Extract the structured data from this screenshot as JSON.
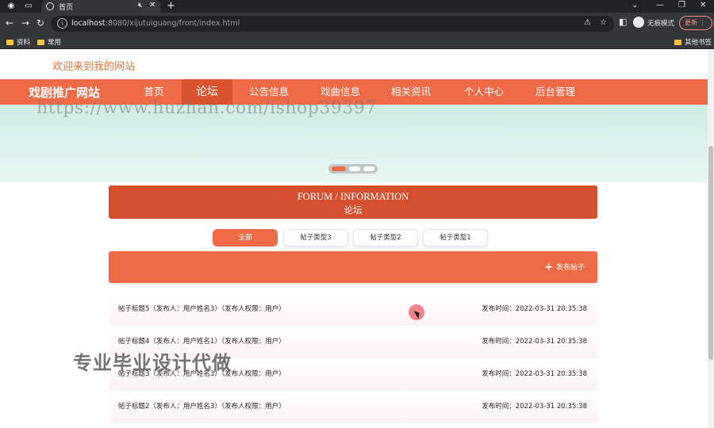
{
  "browser": {
    "tab_title": "首页",
    "url_host": "localhost",
    "url_rest": ":8080/xijutuiguang/front/index.html",
    "profile_label": "无痕模式",
    "update_label": "更新",
    "bookmarks": [
      "资料",
      "常用"
    ],
    "other_bookmarks": "其他书签"
  },
  "header": {
    "welcome": "欢迎来到我的网站",
    "brand": "戏剧推广网站"
  },
  "nav": {
    "items": [
      "首页",
      "论坛",
      "公告信息",
      "戏曲信息",
      "相关资讯",
      "个人中心",
      "后台管理"
    ],
    "active": "论坛"
  },
  "banner": {
    "watermark": "https://www.huzhan.com/ishop39397"
  },
  "forum": {
    "title_en": "FORUM / INFORMATION",
    "title_cn": "论坛",
    "filters": [
      "全部",
      "帖子类型3",
      "帖子类型2",
      "帖子类型1"
    ],
    "active_filter": "全部",
    "post_button": "发布帖子",
    "posts": [
      {
        "title": "帖子标题5（发布人：用户姓名3）（发布人权限：用户）",
        "time": "发布时间：2022-03-31 20:35:38"
      },
      {
        "title": "帖子标题4（发布人：用户姓名1）（发布人权限：用户）",
        "time": "发布时间：2022-03-31 20:35:38"
      },
      {
        "title": "帖子标题3（发布人：用户姓名3）（发布人权限：用户）",
        "time": "发布时间：2022-03-31 20:35:38"
      },
      {
        "title": "帖子标题2（发布人：用户姓名3）（发布人权限：用户）",
        "time": "发布时间：2022-03-31 20:35:38"
      }
    ]
  },
  "overlay": {
    "text": "专业毕业设计代做"
  },
  "colors": {
    "primary": "#ef6a47",
    "primary_dark": "#d4502e",
    "welcome": "#e8743b"
  }
}
